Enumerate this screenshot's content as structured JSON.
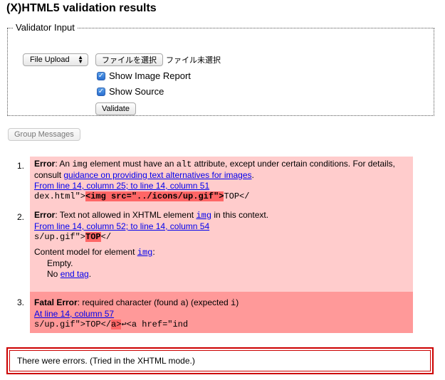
{
  "page": {
    "title": "(X)HTML5 validation results"
  },
  "validator_input": {
    "legend": "Validator Input",
    "mode_select": {
      "selected": "File Upload",
      "arrow_up": "▲",
      "arrow_down": "▼"
    },
    "file_button": "ファイルを選択",
    "file_status": "ファイル未選択",
    "show_image_report": {
      "label": "Show Image Report",
      "checked": true
    },
    "show_source": {
      "label": "Show Source",
      "checked": true
    },
    "checkmark": "✓",
    "validate_button": "Validate"
  },
  "group_messages_button": "Group Messages",
  "messages": [
    {
      "number": "1.",
      "type": "Error",
      "text_parts": {
        "p1": ": An ",
        "code1": "img",
        "p2": " element must have an ",
        "code2": "alt",
        "p3": " attribute, except under certain conditions. For details, consult ",
        "link": "guidance on providing text alternatives for images",
        "p4": "."
      },
      "location": "From line 14, column 25; to line 14, column 51",
      "extract": {
        "before": "dex.html\">",
        "highlight": "<img src=\"../icons/up.gif\">",
        "after": "TOP</"
      }
    },
    {
      "number": "2.",
      "type": "Error",
      "text_parts": {
        "p1": ": Text not allowed in XHTML element ",
        "code1": "img",
        "p2": " in this context."
      },
      "location": "From line 14, column 52; to line 14, column 54",
      "extract": {
        "before": "s/up.gif\">",
        "highlight": "TOP",
        "after": "</"
      },
      "content_model": {
        "intro": "Content model for element ",
        "element": "img",
        "colon": ":",
        "line1": "Empty.",
        "line2_prefix": "No ",
        "line2_link": "end tag",
        "line2_suffix": "."
      }
    },
    {
      "number": "3.",
      "type": "Fatal Error",
      "text_parts": {
        "p1": ": required character (found ",
        "code1": "a",
        "p2": ") (expected ",
        "code2": "i",
        "p3": ")"
      },
      "location": "At line 14, column 57",
      "extract": {
        "before": "s/up.gif\">TOP</",
        "highlight": "a>",
        "after": "↩<a href=\"ind"
      }
    }
  ],
  "summary": "There were errors. (Tried in the XHTML mode.)"
}
